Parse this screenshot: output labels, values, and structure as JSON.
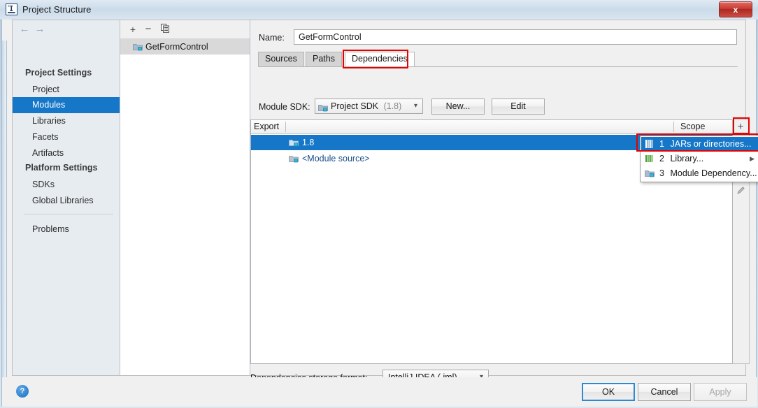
{
  "window": {
    "title": "Project Structure",
    "app_icon": "intellij-idea-icon",
    "close_label": "x",
    "accent_color": "#1677c9",
    "highlight_color": "#e60000"
  },
  "nav_toolbar": {
    "back_icon": "arrow-left-icon",
    "forward_icon": "arrow-right-icon"
  },
  "sidebar": {
    "groups": [
      {
        "title": "Project Settings"
      },
      {
        "title": "Platform Settings"
      }
    ],
    "project_settings_items": [
      {
        "label": "Project",
        "selected": false
      },
      {
        "label": "Modules",
        "selected": true
      },
      {
        "label": "Libraries",
        "selected": false
      },
      {
        "label": "Facets",
        "selected": false
      },
      {
        "label": "Artifacts",
        "selected": false
      }
    ],
    "platform_settings_items": [
      {
        "label": "SDKs",
        "selected": false
      },
      {
        "label": "Global Libraries",
        "selected": false
      }
    ],
    "footer_items": [
      {
        "label": "Problems",
        "selected": false
      }
    ]
  },
  "module_panel": {
    "toolbar": {
      "add_icon": "plus-icon",
      "remove_icon": "minus-icon",
      "copy_icon": "copy-icon"
    },
    "modules": [
      {
        "label": "GetFormControl",
        "icon": "module-icon",
        "selected": true
      }
    ]
  },
  "editor": {
    "name_label": "Name:",
    "name_value": "GetFormControl",
    "tabs": [
      {
        "label": "Sources",
        "active": false
      },
      {
        "label": "Paths",
        "active": false
      },
      {
        "label": "Dependencies",
        "active": true,
        "highlighted": true
      }
    ],
    "sdk": {
      "label": "Module SDK:",
      "value": "Project SDK",
      "version": "(1.8)",
      "icon": "sdk-icon",
      "chevron": "chevron-down-icon",
      "new_button": "New...",
      "edit_button": "Edit"
    },
    "dependencies_table": {
      "columns": [
        "Export",
        "Scope"
      ],
      "rows": [
        {
          "name": "1.8",
          "icon": "jdk-folder-icon",
          "selected": true,
          "export": "",
          "scope": ""
        },
        {
          "name": "<Module source>",
          "icon": "module-source-icon",
          "selected": false,
          "export": "",
          "scope": ""
        }
      ]
    },
    "table_toolbar": {
      "add_icon": "plus-icon",
      "remove_icon": "minus-icon",
      "move_up_icon": "triangle-up-icon",
      "move_down_icon": "triangle-down-icon",
      "edit_icon": "pencil-icon"
    },
    "add_menu": {
      "items": [
        {
          "number": "1",
          "label": "JARs or directories...",
          "icon": "jars-icon",
          "highlighted": true,
          "submenu": false
        },
        {
          "number": "2",
          "label": "Library...",
          "icon": "library-icon",
          "highlighted": false,
          "submenu": true
        },
        {
          "number": "3",
          "label": "Module Dependency...",
          "icon": "module-dependency-icon",
          "highlighted": false,
          "submenu": false
        }
      ]
    },
    "storage": {
      "label": "Dependencies storage format:",
      "value": "IntelliJ IDEA (.iml)",
      "chevron": "chevron-down-icon"
    }
  },
  "footer": {
    "help_label": "?",
    "buttons": [
      {
        "label": "OK",
        "name": "ok-button",
        "enabled": true,
        "default": true
      },
      {
        "label": "Cancel",
        "name": "cancel-button",
        "enabled": true,
        "default": false
      },
      {
        "label": "Apply",
        "name": "apply-button",
        "enabled": false,
        "default": false
      }
    ]
  }
}
